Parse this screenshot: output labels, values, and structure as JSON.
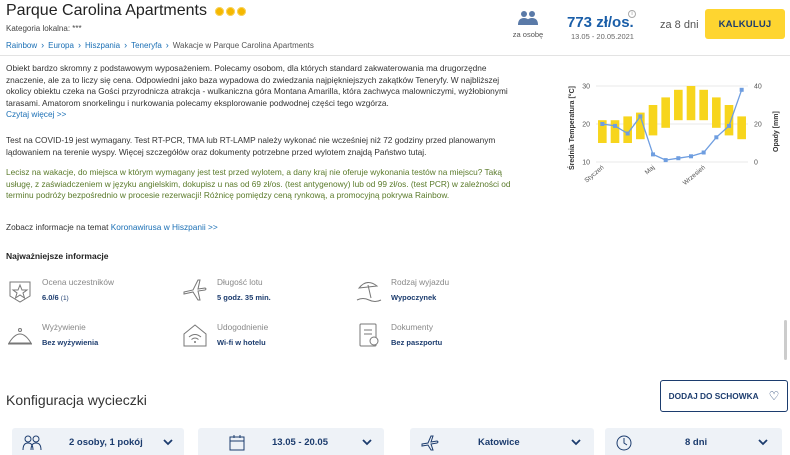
{
  "header": {
    "title": "Parque Carolina Apartments",
    "category": "Kategoria lokalna: ***",
    "persons_label": "za osobę",
    "price": "773 zł/os.",
    "dates": "13.05 - 20.05.2021",
    "duration": "za 8 dni",
    "calc_label": "KALKULUJ",
    "info_icon": "i"
  },
  "breadcrumb": [
    "Rainbow",
    "Europa",
    "Hiszpania",
    "Teneryfa",
    "Wakacje w Parque Carolina Apartments"
  ],
  "description": {
    "para1": "Obiekt bardzo skromny z podstawowym wyposażeniem. Polecamy osobom, dla których standard zakwaterowania ma drugorzędne znaczenie, ale za to liczy się cena. Odpowiedni jako baza wypadowa do zwiedzania najpiękniejszych zakątków Teneryfy. W najbliższej okolicy obiektu czeka na Gości przyrodnicza atrakcja - wulkaniczna góra Montana Amarilla, która zachwyca malowniczymi, wyżłobionymi tarasami. Amatorom snorkelingu i nurkowania polecamy eksplorowanie podwodnej części tego wzgórza.",
    "read_more": "Czytaj więcej >>",
    "covid_text": "Test na COVID-19 jest wymagany. Test RT-PCR, TMA lub RT-LAMP należy wykonać nie wcześniej niż 72 godziny przed planowanym lądowaniem na terenie wyspy. Więcej szczegółów oraz dokumenty potrzebne przed wylotem znajdą Państwo",
    "covid_link": "tutaj",
    "green_text": "Lecisz na wakacje, do miejsca w którym wymagany jest test przed wylotem, a dany kraj nie oferuje wykonania testów na miejscu? Taką usługę, z zaświadczeniem w języku angielskim, dokupisz u nas od 69 zł/os. (test antygenowy) lub od 99 zł/os. (test PCR) w zależności od terminu podróży bezpośrednio w procesie rezerwacji! Różnicę pomiędzy ceną rynkową, a promocyjną pokrywa Rainbow.",
    "corona_prefix": "Zobacz informacje na temat",
    "corona_link": "Koronawirusa w Hiszpanii >>"
  },
  "info": {
    "title": "Najważniejsze informacje",
    "items": [
      {
        "key": "Ocena uczestników",
        "value": "6.0/6",
        "extra": "(1)",
        "icon": "star-badge-icon"
      },
      {
        "key": "Długość lotu",
        "value": "5 godz. 35 min.",
        "extra": "",
        "icon": "plane-icon"
      },
      {
        "key": "Rodzaj wyjazdu",
        "value": "Wypoczynek",
        "extra": "",
        "icon": "beach-icon"
      },
      {
        "key": "Wyżywienie",
        "value": "Bez wyżywienia",
        "extra": "",
        "icon": "food-icon"
      },
      {
        "key": "Udogodnienie",
        "value": "Wi-fi w hotelu",
        "extra": "",
        "icon": "wifi-icon"
      },
      {
        "key": "Dokumenty",
        "value": "Bez paszportu",
        "extra": "",
        "icon": "document-icon"
      }
    ]
  },
  "config": {
    "title": "Konfiguracja wycieczki",
    "fav_label": "DODAJ DO SCHOWKA",
    "pills": [
      "2 osoby, 1 pokój",
      "13.05 - 20.05",
      "Katowice",
      "8 dni"
    ]
  },
  "colors": {
    "accent_yellow": "#fed530",
    "brand_blue": "#1c3c6e",
    "link_blue": "#1a6fb5",
    "price_blue": "#1a5ea8",
    "bar_yellow": "#f7d51d",
    "line_blue": "#6f9ee0"
  },
  "chart_data": {
    "type": "bar",
    "categories": [
      "I",
      "II",
      "III",
      "IV",
      "V",
      "VI",
      "VII",
      "VIII",
      "IX",
      "X",
      "XI",
      "XII"
    ],
    "xtick_labels": [
      "Styczeń",
      "Maj",
      "Wrzesień"
    ],
    "xtick_positions": [
      0,
      4,
      8
    ],
    "series": [
      {
        "name": "",
        "type": "bar",
        "axis": "left",
        "values": [
          [
            15,
            21
          ],
          [
            15,
            21
          ],
          [
            15,
            22
          ],
          [
            16,
            23
          ],
          [
            17,
            25
          ],
          [
            19,
            27
          ],
          [
            21,
            29
          ],
          [
            21,
            30
          ],
          [
            21,
            29
          ],
          [
            19,
            27
          ],
          [
            17,
            25
          ],
          [
            16,
            22
          ]
        ]
      },
      {
        "name": "",
        "type": "line",
        "axis": "right",
        "values": [
          20,
          19,
          15,
          24,
          4,
          1,
          2,
          3,
          5,
          13,
          19,
          38
        ]
      }
    ],
    "ylabel_left": "Średnia Temperatura [°C]",
    "ylabel_right": "Opady [mm]",
    "ylim_left": [
      10,
      30
    ],
    "yticks_left": [
      10,
      20,
      30
    ],
    "ylim_right": [
      0,
      40
    ],
    "yticks_right": [
      0,
      20,
      40
    ],
    "grid": true
  }
}
